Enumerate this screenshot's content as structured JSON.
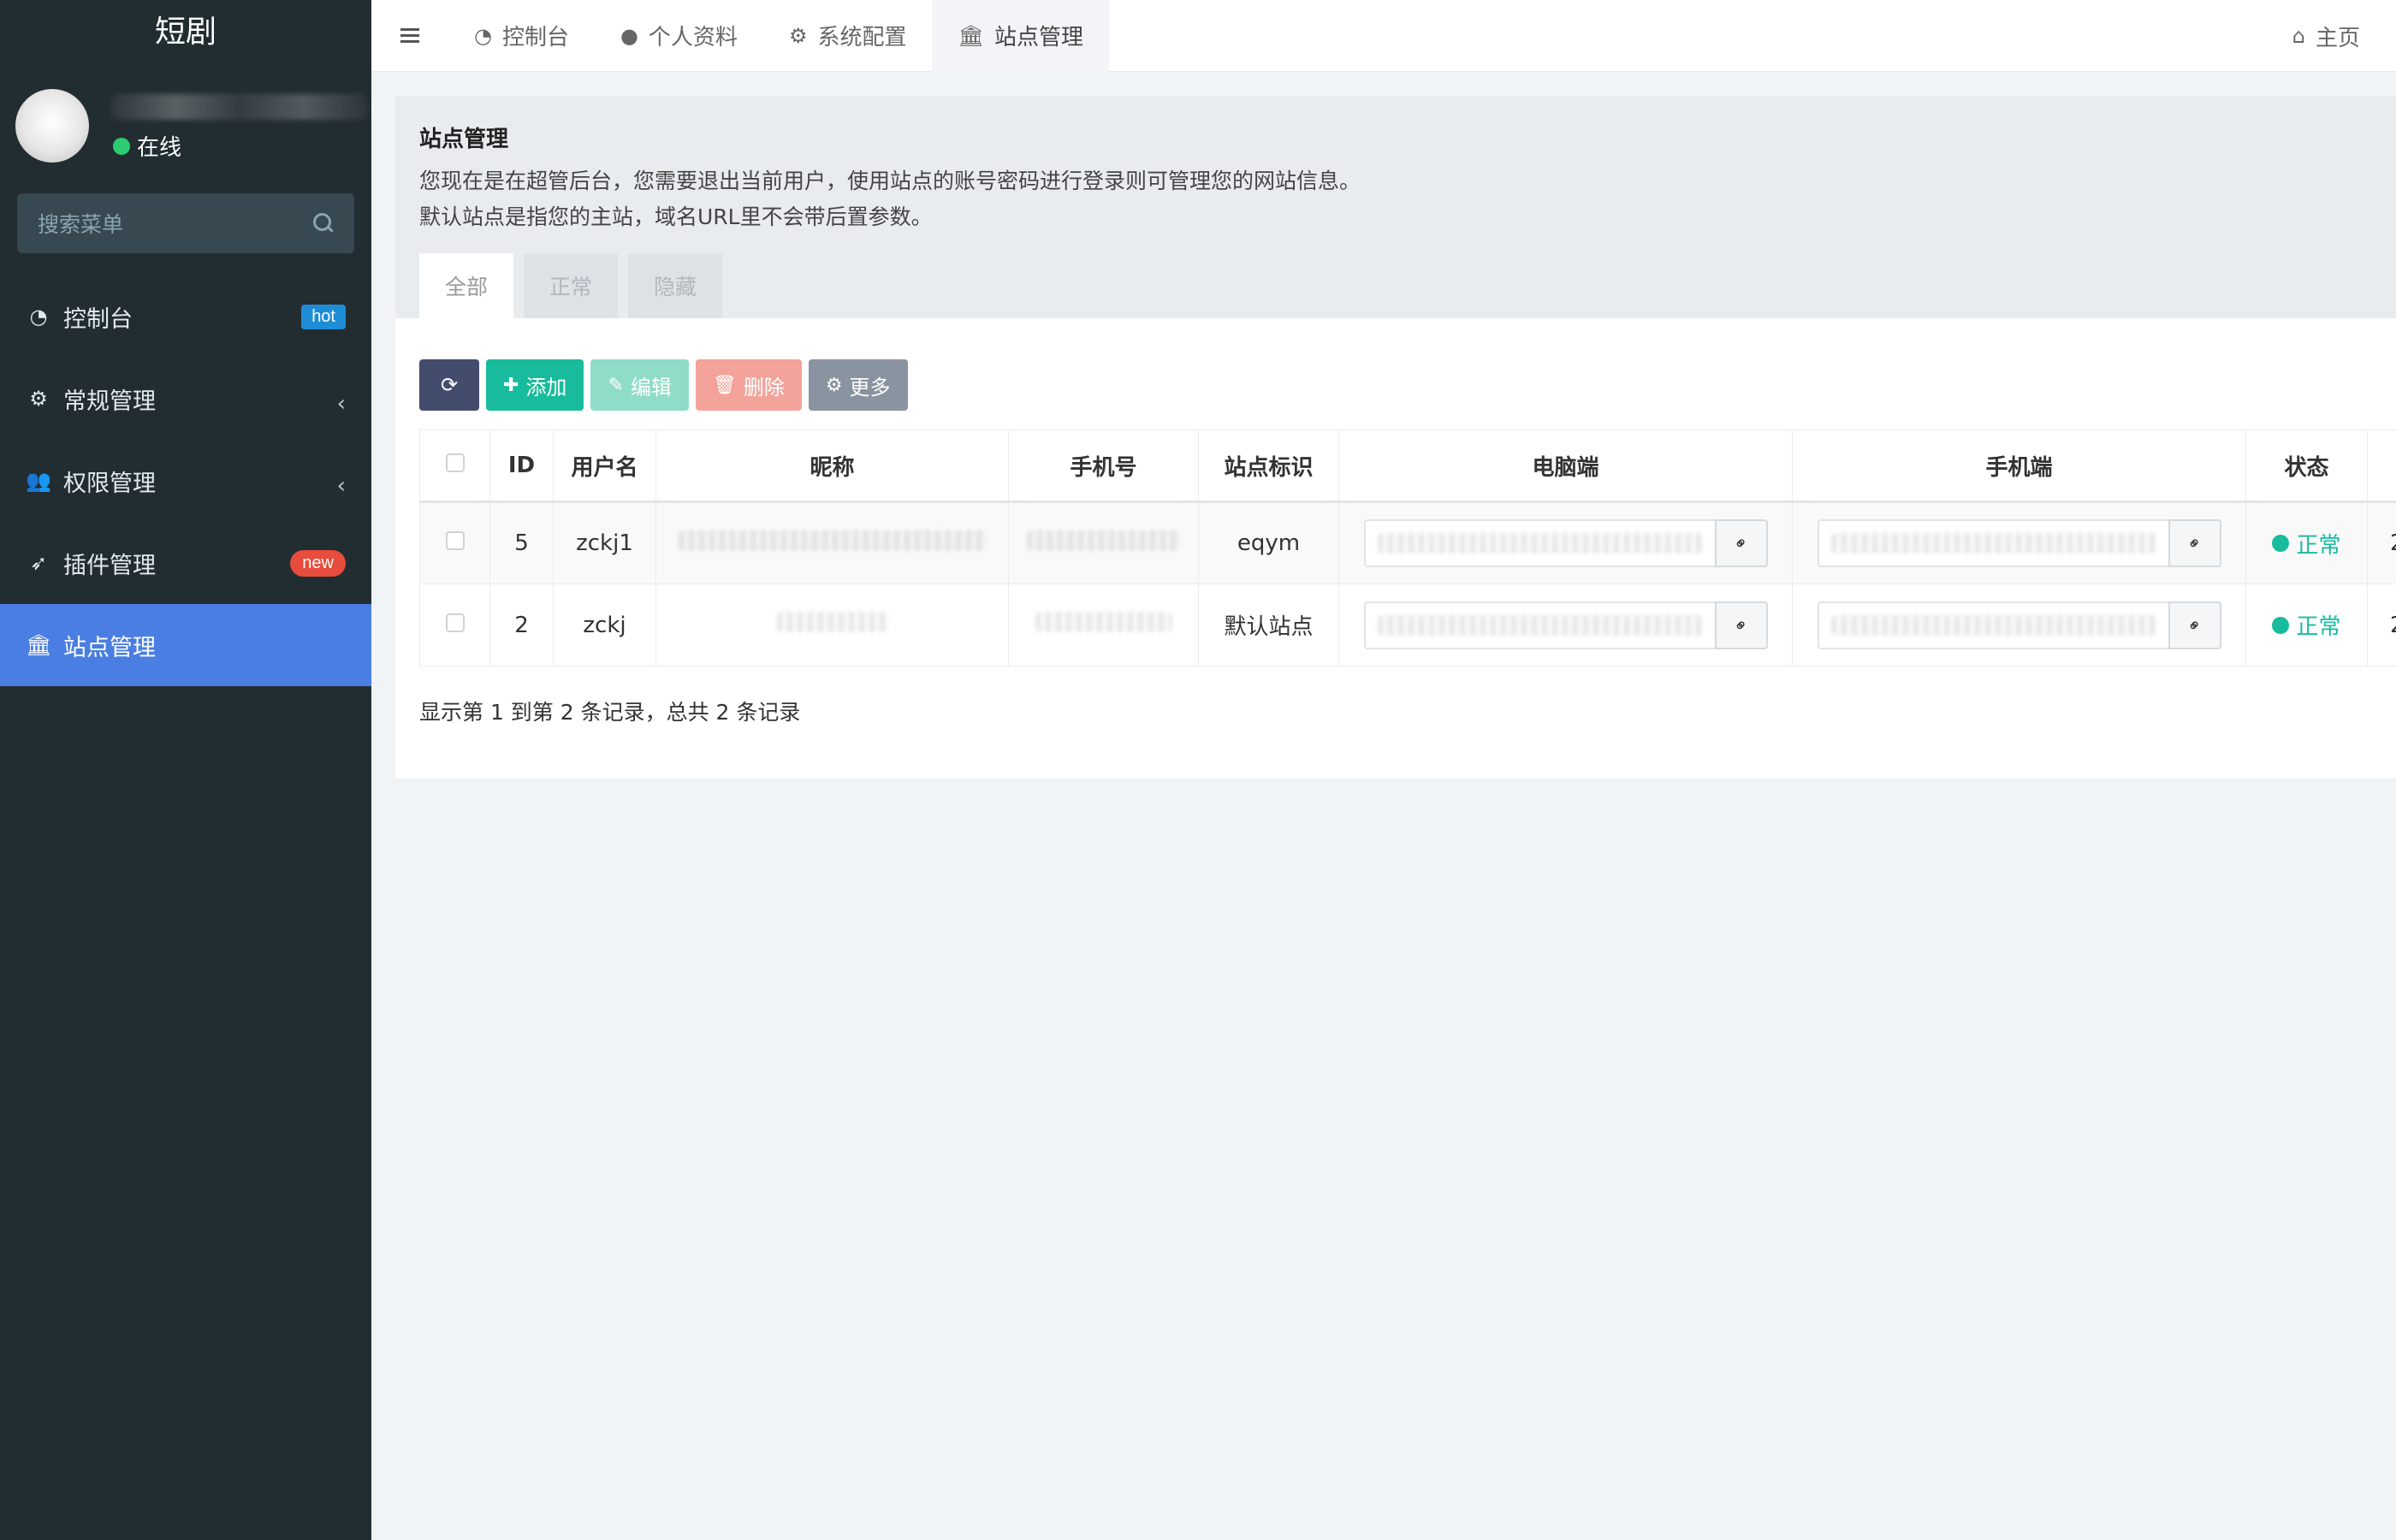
{
  "sidebar": {
    "logo": "短剧",
    "user_status": "在线",
    "search_placeholder": "搜索菜单",
    "items": [
      {
        "label": "控制台",
        "icon": "dashboard-icon",
        "badge": "hot"
      },
      {
        "label": "常规管理",
        "icon": "cogs-icon"
      },
      {
        "label": "权限管理",
        "icon": "users-icon"
      },
      {
        "label": "插件管理",
        "icon": "rocket-icon",
        "badge": "new"
      },
      {
        "label": "站点管理",
        "icon": "bank-icon",
        "active": true
      }
    ]
  },
  "topnav": {
    "tabs": [
      {
        "label": "控制台",
        "icon": "dashboard-icon"
      },
      {
        "label": "个人资料",
        "icon": "user-icon"
      },
      {
        "label": "系统配置",
        "icon": "gear-icon"
      },
      {
        "label": "站点管理",
        "icon": "bank-icon",
        "active": true
      }
    ],
    "home_label": "主页"
  },
  "page": {
    "title": "站点管理",
    "desc_line1": "您现在是在超管后台，您需要退出当前用户，使用站点的账号密码进行登录则可管理您的网站信息。",
    "desc_line2": "默认站点是指您的主站，域名URL里不会带后置参数。",
    "filter_tabs": [
      "全部",
      "正常",
      "隐藏"
    ]
  },
  "toolbar": {
    "add": "添加",
    "edit": "编辑",
    "delete": "删除",
    "more": "更多"
  },
  "table": {
    "headers": [
      "ID",
      "用户名",
      "昵称",
      "手机号",
      "站点标识",
      "电脑端",
      "手机端",
      "状态"
    ],
    "rows": [
      {
        "id": "5",
        "username": "zckj1",
        "site_key": "eqym",
        "status": "正常",
        "extra": "2"
      },
      {
        "id": "2",
        "username": "zckj",
        "site_key": "默认站点",
        "status": "正常",
        "extra": "2"
      }
    ],
    "summary": "显示第 1 到第 2 条记录，总共 2 条记录"
  },
  "colors": {
    "sidebar_bg": "#222d32",
    "active_item": "#4a7ee2",
    "success": "#18bc9c",
    "hot_badge": "#1f8dd6",
    "new_badge": "#e74c3c"
  }
}
